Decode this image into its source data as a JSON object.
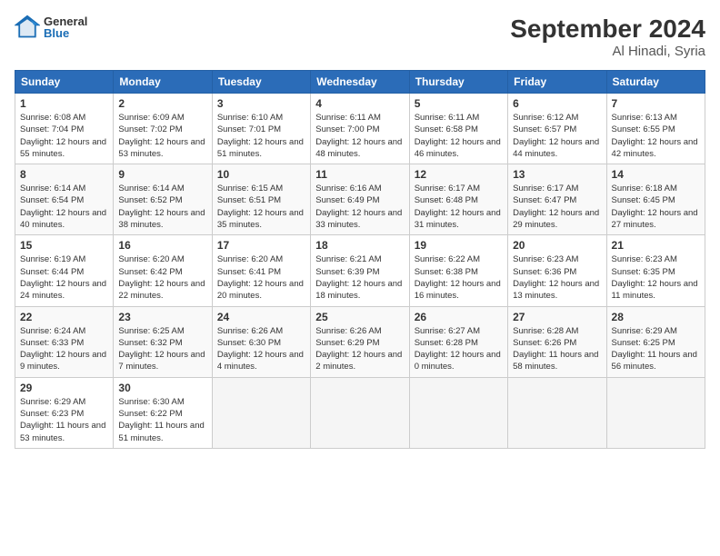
{
  "header": {
    "logo_general": "General",
    "logo_blue": "Blue",
    "month_year": "September 2024",
    "location": "Al Hinadi, Syria"
  },
  "days_of_week": [
    "Sunday",
    "Monday",
    "Tuesday",
    "Wednesday",
    "Thursday",
    "Friday",
    "Saturday"
  ],
  "weeks": [
    [
      {
        "day": 1,
        "sunrise": "6:08 AM",
        "sunset": "7:04 PM",
        "daylight": "12 hours and 55 minutes."
      },
      {
        "day": 2,
        "sunrise": "6:09 AM",
        "sunset": "7:02 PM",
        "daylight": "12 hours and 53 minutes."
      },
      {
        "day": 3,
        "sunrise": "6:10 AM",
        "sunset": "7:01 PM",
        "daylight": "12 hours and 51 minutes."
      },
      {
        "day": 4,
        "sunrise": "6:11 AM",
        "sunset": "7:00 PM",
        "daylight": "12 hours and 48 minutes."
      },
      {
        "day": 5,
        "sunrise": "6:11 AM",
        "sunset": "6:58 PM",
        "daylight": "12 hours and 46 minutes."
      },
      {
        "day": 6,
        "sunrise": "6:12 AM",
        "sunset": "6:57 PM",
        "daylight": "12 hours and 44 minutes."
      },
      {
        "day": 7,
        "sunrise": "6:13 AM",
        "sunset": "6:55 PM",
        "daylight": "12 hours and 42 minutes."
      }
    ],
    [
      {
        "day": 8,
        "sunrise": "6:14 AM",
        "sunset": "6:54 PM",
        "daylight": "12 hours and 40 minutes."
      },
      {
        "day": 9,
        "sunrise": "6:14 AM",
        "sunset": "6:52 PM",
        "daylight": "12 hours and 38 minutes."
      },
      {
        "day": 10,
        "sunrise": "6:15 AM",
        "sunset": "6:51 PM",
        "daylight": "12 hours and 35 minutes."
      },
      {
        "day": 11,
        "sunrise": "6:16 AM",
        "sunset": "6:49 PM",
        "daylight": "12 hours and 33 minutes."
      },
      {
        "day": 12,
        "sunrise": "6:17 AM",
        "sunset": "6:48 PM",
        "daylight": "12 hours and 31 minutes."
      },
      {
        "day": 13,
        "sunrise": "6:17 AM",
        "sunset": "6:47 PM",
        "daylight": "12 hours and 29 minutes."
      },
      {
        "day": 14,
        "sunrise": "6:18 AM",
        "sunset": "6:45 PM",
        "daylight": "12 hours and 27 minutes."
      }
    ],
    [
      {
        "day": 15,
        "sunrise": "6:19 AM",
        "sunset": "6:44 PM",
        "daylight": "12 hours and 24 minutes."
      },
      {
        "day": 16,
        "sunrise": "6:20 AM",
        "sunset": "6:42 PM",
        "daylight": "12 hours and 22 minutes."
      },
      {
        "day": 17,
        "sunrise": "6:20 AM",
        "sunset": "6:41 PM",
        "daylight": "12 hours and 20 minutes."
      },
      {
        "day": 18,
        "sunrise": "6:21 AM",
        "sunset": "6:39 PM",
        "daylight": "12 hours and 18 minutes."
      },
      {
        "day": 19,
        "sunrise": "6:22 AM",
        "sunset": "6:38 PM",
        "daylight": "12 hours and 16 minutes."
      },
      {
        "day": 20,
        "sunrise": "6:23 AM",
        "sunset": "6:36 PM",
        "daylight": "12 hours and 13 minutes."
      },
      {
        "day": 21,
        "sunrise": "6:23 AM",
        "sunset": "6:35 PM",
        "daylight": "12 hours and 11 minutes."
      }
    ],
    [
      {
        "day": 22,
        "sunrise": "6:24 AM",
        "sunset": "6:33 PM",
        "daylight": "12 hours and 9 minutes."
      },
      {
        "day": 23,
        "sunrise": "6:25 AM",
        "sunset": "6:32 PM",
        "daylight": "12 hours and 7 minutes."
      },
      {
        "day": 24,
        "sunrise": "6:26 AM",
        "sunset": "6:30 PM",
        "daylight": "12 hours and 4 minutes."
      },
      {
        "day": 25,
        "sunrise": "6:26 AM",
        "sunset": "6:29 PM",
        "daylight": "12 hours and 2 minutes."
      },
      {
        "day": 26,
        "sunrise": "6:27 AM",
        "sunset": "6:28 PM",
        "daylight": "12 hours and 0 minutes."
      },
      {
        "day": 27,
        "sunrise": "6:28 AM",
        "sunset": "6:26 PM",
        "daylight": "11 hours and 58 minutes."
      },
      {
        "day": 28,
        "sunrise": "6:29 AM",
        "sunset": "6:25 PM",
        "daylight": "11 hours and 56 minutes."
      }
    ],
    [
      {
        "day": 29,
        "sunrise": "6:29 AM",
        "sunset": "6:23 PM",
        "daylight": "11 hours and 53 minutes."
      },
      {
        "day": 30,
        "sunrise": "6:30 AM",
        "sunset": "6:22 PM",
        "daylight": "11 hours and 51 minutes."
      },
      null,
      null,
      null,
      null,
      null
    ]
  ],
  "labels": {
    "sunrise": "Sunrise:",
    "sunset": "Sunset:",
    "daylight": "Daylight:"
  }
}
